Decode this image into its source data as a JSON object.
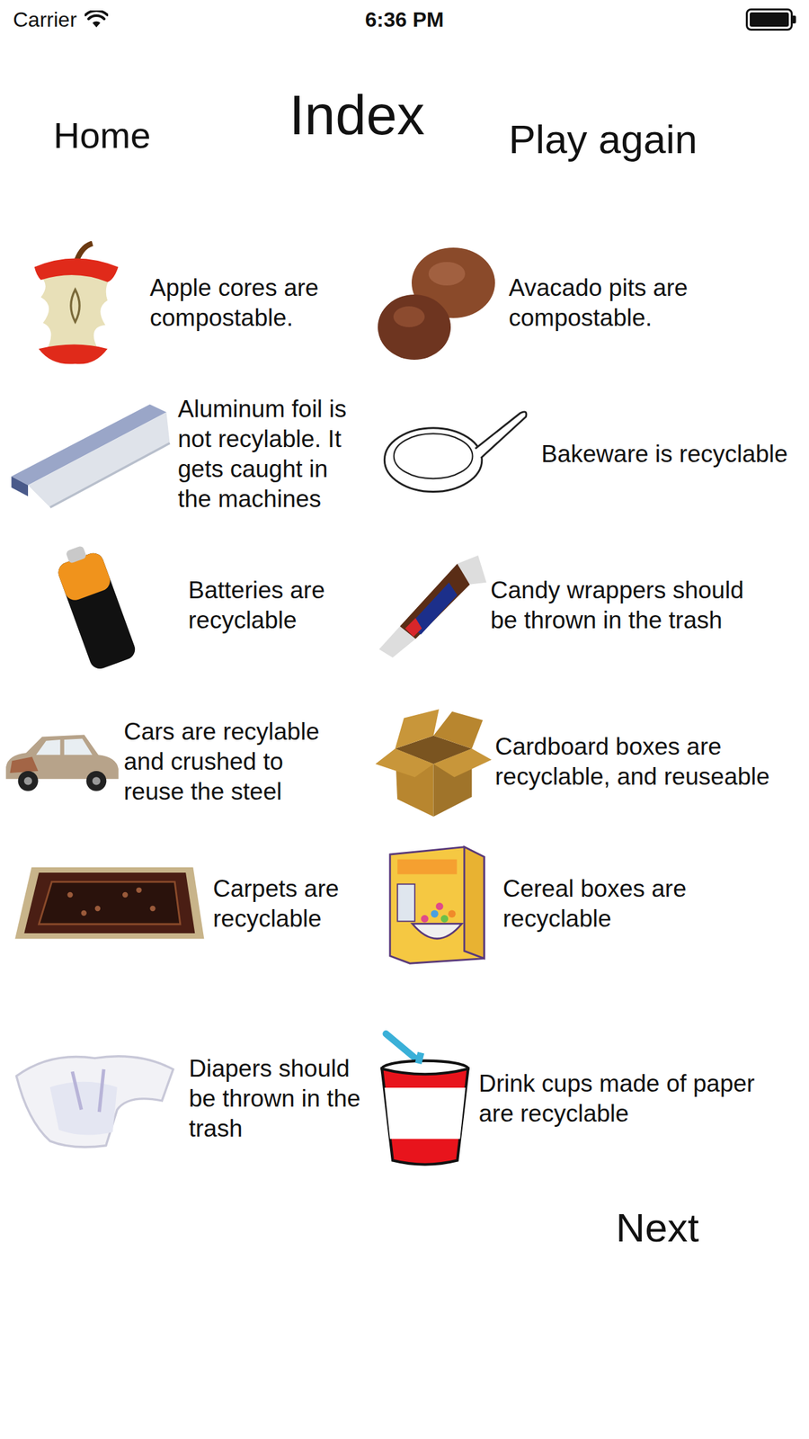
{
  "status_bar": {
    "carrier": "Carrier",
    "time": "6:36 PM",
    "battery_level": 1
  },
  "header": {
    "home": "Home",
    "title": "Index",
    "play_again": "Play again"
  },
  "items": [
    {
      "text": "Apple cores are compostable."
    },
    {
      "text": "Avacado pits are compostable."
    },
    {
      "text": "Aluminum foil is not recylable. It gets caught in the machines"
    },
    {
      "text": "Bakeware is recyclable"
    },
    {
      "text": "Batteries are recyclable"
    },
    {
      "text": "Candy wrappers should be thrown in the trash"
    },
    {
      "text": "Cars are recylable and crushed to reuse the steel"
    },
    {
      "text": "Cardboard boxes are recyclable, and reuseable"
    },
    {
      "text": "Carpets are recyclable"
    },
    {
      "text": "Cereal boxes are recyclable"
    },
    {
      "text": "Diapers should be thrown in the trash"
    },
    {
      "text": "Drink cups made of paper are recyclable"
    }
  ],
  "next": "Next"
}
